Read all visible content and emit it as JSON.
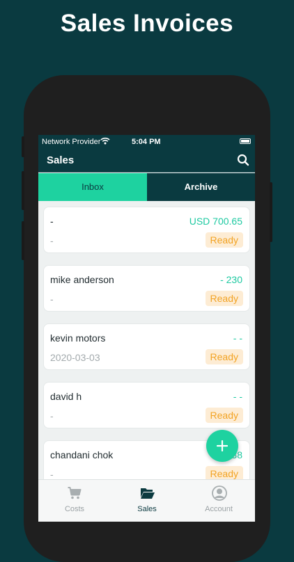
{
  "headline": "Sales Invoices",
  "status_bar": {
    "provider": "Network Provider",
    "time": "5:04 PM"
  },
  "app_bar": {
    "title": "Sales"
  },
  "tabs": [
    {
      "label": "Inbox",
      "active": true
    },
    {
      "label": "Archive",
      "active": false
    }
  ],
  "invoices": [
    {
      "customer": "-",
      "amount": "USD 700.65",
      "date": "-",
      "status": "Ready"
    },
    {
      "customer": "mike anderson",
      "amount": "- 230",
      "date": "-",
      "status": "Ready"
    },
    {
      "customer": "kevin motors",
      "amount": "- -",
      "date": "2020-03-03",
      "status": "Ready"
    },
    {
      "customer": "david h",
      "amount": "- -",
      "date": "-",
      "status": "Ready"
    },
    {
      "customer": "chandani chok",
      "amount": "R 38",
      "date": "-",
      "status": "Ready"
    }
  ],
  "fab": {
    "icon": "plus-icon"
  },
  "bottom_nav": [
    {
      "label": "Costs",
      "icon": "cart-icon",
      "active": false
    },
    {
      "label": "Sales",
      "icon": "folder-open-icon",
      "active": true
    },
    {
      "label": "Account",
      "icon": "user-circle-icon",
      "active": false
    }
  ],
  "colors": {
    "brand_dark": "#0a3a40",
    "accent": "#1ed2a0",
    "status_ready_text": "#f2a324",
    "status_ready_bg": "#fdecd4"
  }
}
